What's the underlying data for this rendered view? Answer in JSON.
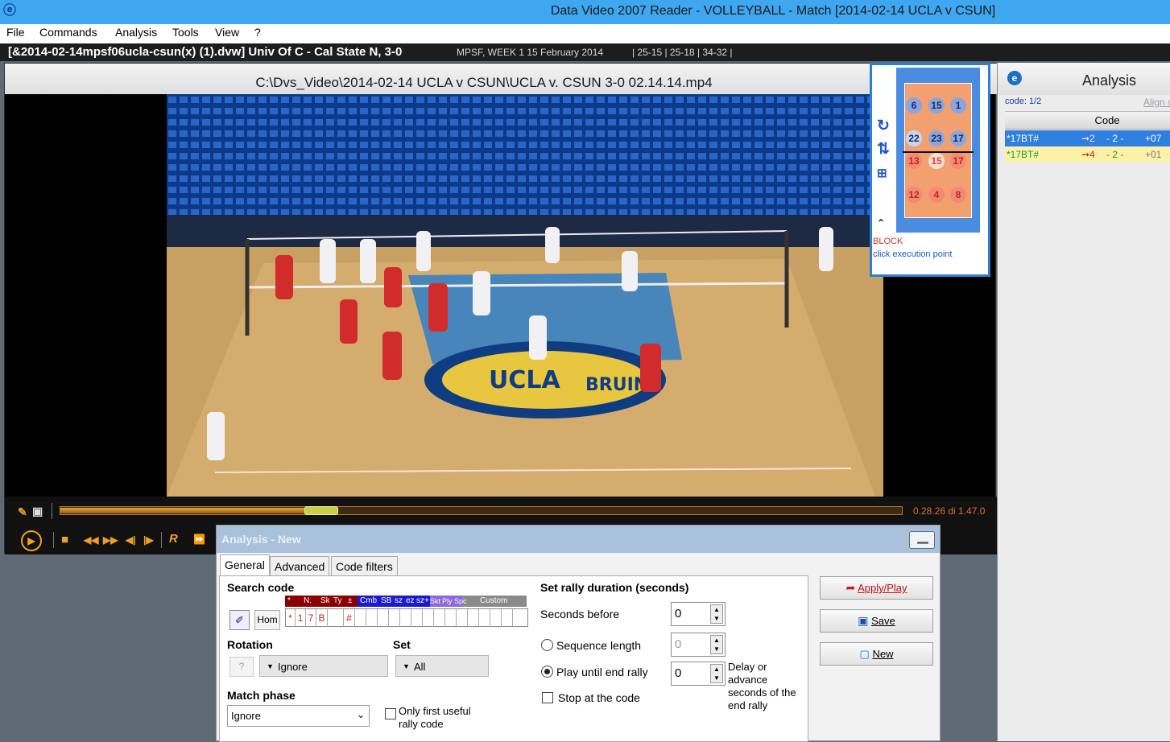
{
  "window": {
    "title": "Data Video 2007 Reader - VOLLEYBALL - Match [2014-02-14 UCLA v CSUN]"
  },
  "menu": [
    "File",
    "Commands",
    "Analysis",
    "Tools",
    "View",
    "?"
  ],
  "infobar": {
    "file": "[&2014-02-14mpsf06ucla-csun(x) (1).dvw] Univ Of C - Cal State N, 3-0",
    "meta": "MPSF, WEEK 1 15 February 2014",
    "sets": "| 25-15 | 25-18 | 34-32 |"
  },
  "video": {
    "path": "C:\\Dvs_Video\\2014-02-14 UCLA v CSUN\\UCLA v. CSUN 3-0 02.14.14.mp4",
    "time": "0.28.26 di 1.47.0",
    "progress": 0.31,
    "floor_text": [
      "UCLA",
      "BRUINS"
    ]
  },
  "rotation_widget": {
    "top_players": [
      "6",
      "15",
      "1"
    ],
    "front_blue": [
      "22",
      "23",
      "17"
    ],
    "front_red": [
      "13",
      "15",
      "17"
    ],
    "back_red": [
      "12",
      "4",
      "8"
    ],
    "label": "BLOCK",
    "hint": "click execution point"
  },
  "analysis_panel": {
    "title": "Analysis",
    "count": "code: 1/2",
    "align": "Align c",
    "column": "Code",
    "rows": [
      {
        "code": "*17BT#",
        "arrow": "➞2",
        "zone": "- 2 -",
        "score": "+07",
        "selected": true
      },
      {
        "code": "*17BT#",
        "arrow": "➞4",
        "zone": "- 2 -",
        "score": "+01",
        "selected": false
      }
    ]
  },
  "dialog": {
    "title": "Analysis - New",
    "tabs": [
      "General",
      "Advanced",
      "Code filters"
    ],
    "search_code_label": "Search code",
    "home_button": "Hom",
    "code_header": [
      "*",
      "N.",
      "Sk",
      "Ty",
      "±",
      "Cmb",
      "SB",
      "sz",
      "ez",
      "sz+",
      "Skt",
      "Ply",
      "Spc",
      "Custom"
    ],
    "code_values": [
      "*",
      "1",
      "7",
      "B",
      "",
      "#"
    ],
    "rotation_label": "Rotation",
    "rotation_q": "?",
    "rotation_value": "Ignore",
    "set_label": "Set",
    "set_value": "All",
    "match_phase_label": "Match phase",
    "match_phase_value": "Ignore",
    "only_first_label": "Only first useful rally code",
    "rally_duration_label": "Set rally duration (seconds)",
    "seconds_before_label": "Seconds before",
    "seconds_before_value": "0",
    "sequence_length_label": "Sequence length",
    "sequence_length_value": "0",
    "play_until_label": "Play until end rally",
    "play_until_value": "0",
    "stop_label": "Stop at the code",
    "delay_note": "Delay or advance seconds of the end rally",
    "apply_label": "Apply/Play",
    "save_label": "Save",
    "new_label": "New"
  }
}
